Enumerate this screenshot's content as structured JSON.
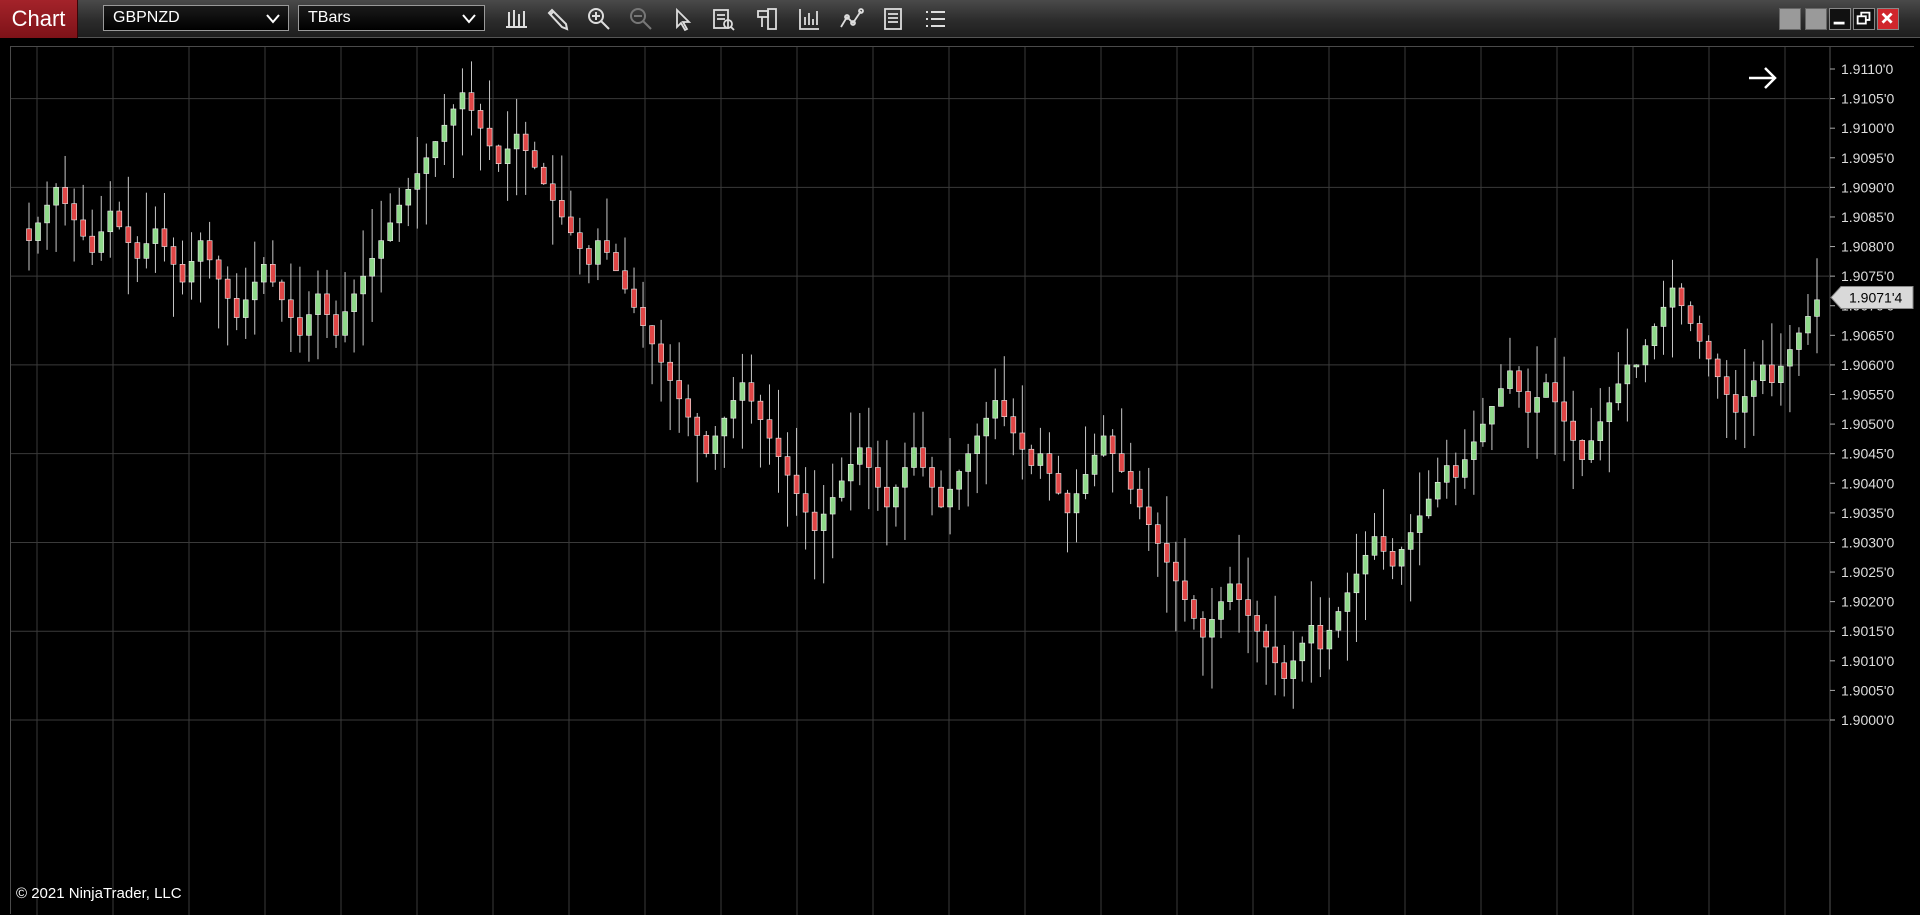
{
  "toolbar": {
    "title": "Chart",
    "instrument": "GBPNZD",
    "bar_type": "TBars",
    "tools": [
      {
        "icon": "bar-type-icon"
      },
      {
        "icon": "pencil-icon"
      },
      {
        "icon": "zoom-in-icon"
      },
      {
        "icon": "zoom-out-icon"
      },
      {
        "icon": "pointer-icon"
      },
      {
        "icon": "data-box-icon"
      },
      {
        "icon": "templates-icon"
      },
      {
        "icon": "indicators-icon"
      },
      {
        "icon": "strategies-icon"
      },
      {
        "icon": "properties-icon"
      },
      {
        "icon": "list-icon"
      }
    ]
  },
  "colors": {
    "background": "#000000",
    "grid": "#3a3a3a",
    "up_candle": "#8fd98a",
    "down_candle": "#e04646",
    "wick": "#c8c8c8",
    "title_tab": "#9b1c22",
    "price_marker": "#d9d9d9"
  },
  "chart_data": {
    "type": "candlestick",
    "instrument": "GBPNZD",
    "bar_type": "TBars",
    "ylim": [
      1.8998,
      1.9115
    ],
    "y_ticks": [
      "1.9110'0",
      "1.9105'0",
      "1.9100'0",
      "1.9095'0",
      "1.9090'0",
      "1.9085'0",
      "1.9080'0",
      "1.9075'0",
      "1.9070'0",
      "1.9065'0",
      "1.9060'0",
      "1.9055'0",
      "1.9050'0",
      "1.9045'0",
      "1.9040'0",
      "1.9035'0",
      "1.9030'0",
      "1.9025'0",
      "1.9020'0",
      "1.9015'0",
      "1.9010'0",
      "1.9005'0",
      "1.9000'0"
    ],
    "y_tick_values": [
      1.911,
      1.9105,
      1.91,
      1.9095,
      1.909,
      1.9085,
      1.908,
      1.9075,
      1.907,
      1.9065,
      1.906,
      1.9055,
      1.905,
      1.9045,
      1.904,
      1.9035,
      1.903,
      1.9025,
      1.902,
      1.9015,
      1.901,
      1.9005,
      1.9
    ],
    "last_price_label": "1.9071'4",
    "last_price": 1.90714,
    "grid": true,
    "swing_points": [
      [
        1.9083,
        1.9081,
        1.909,
        1.9079,
        1.9086,
        1.9078,
        1.9083,
        1.9074,
        1.9081,
        1.9068,
        1.9077,
        1.9065,
        1.9072,
        1.9065,
        1.9069,
        1.9087,
        1.9095,
        1.9106,
        1.9094,
        1.9099,
        1.9085,
        1.9077,
        1.9081,
        1.9079,
        1.9045,
        1.9057,
        1.9032,
        1.9046,
        1.9036,
        1.9046,
        1.9036,
        1.9054,
        1.9043,
        1.9045,
        1.9035,
        1.9048,
        1.9033,
        1.9014,
        1.9023,
        1.9015,
        1.9007,
        1.9016,
        1.9012,
        1.9031,
        1.9026,
        1.9043,
        1.9041,
        1.9059,
        1.9052,
        1.9057,
        1.9044,
        1.906,
        1.906,
        1.9073,
        1.9052,
        1.906,
        1.9057,
        1.9071
      ]
    ],
    "copyright": "© 2021 NinjaTrader, LLC"
  }
}
